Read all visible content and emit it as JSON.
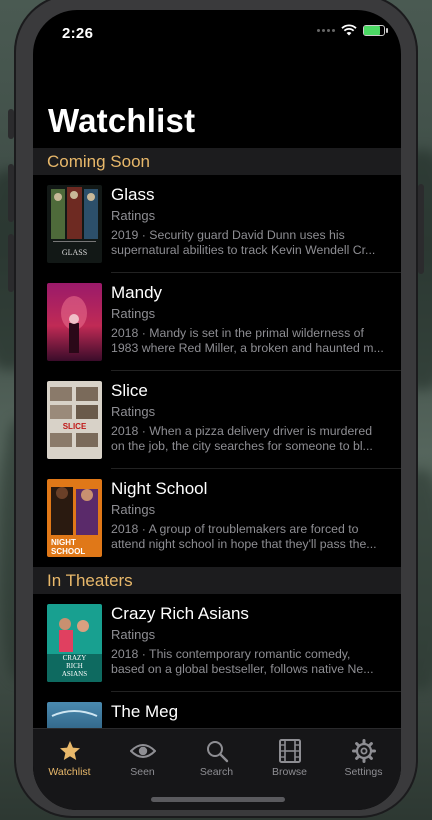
{
  "status": {
    "time": "2:26"
  },
  "page": {
    "title": "Watchlist"
  },
  "sections": [
    {
      "header": "Coming Soon",
      "movies": [
        {
          "title": "Glass",
          "ratings": "Ratings",
          "desc_line1": "2019 · Security guard David Dunn uses his",
          "desc_line2": "supernatural abilities to track Kevin Wendell Cr...",
          "poster_text": "GLASS"
        },
        {
          "title": "Mandy",
          "ratings": "Ratings",
          "desc_line1": "2018 · Mandy is set in the primal wilderness of",
          "desc_line2": "1983 where Red Miller, a broken and haunted m...",
          "poster_text": ""
        },
        {
          "title": "Slice",
          "ratings": "Ratings",
          "desc_line1": "2018 · When a pizza delivery driver is murdered",
          "desc_line2": "on the job, the city searches for someone to bl...",
          "poster_text": "SLICE"
        },
        {
          "title": "Night School",
          "ratings": "Ratings",
          "desc_line1": "2018 · A group of troublemakers are forced to",
          "desc_line2": "attend night school in hope that they'll pass the...",
          "poster_text_1": "NIGHT",
          "poster_text_2": "SCHOOL"
        }
      ]
    },
    {
      "header": "In Theaters",
      "movies": [
        {
          "title": "Crazy Rich Asians",
          "ratings": "Ratings",
          "desc_line1": "2018 · This contemporary romantic comedy,",
          "desc_line2": "based on a global bestseller, follows native Ne...",
          "poster_text_1": "CRAZY",
          "poster_text_2": "RICH",
          "poster_text_3": "ASIANS"
        },
        {
          "title": "The Meg",
          "ratings": "",
          "desc_line1": "",
          "desc_line2": ""
        }
      ]
    }
  ],
  "tabs": [
    {
      "label": "Watchlist",
      "icon": "star-icon",
      "active": true
    },
    {
      "label": "Seen",
      "icon": "eye-icon",
      "active": false
    },
    {
      "label": "Search",
      "icon": "search-icon",
      "active": false
    },
    {
      "label": "Browse",
      "icon": "film-icon",
      "active": false
    },
    {
      "label": "Settings",
      "icon": "gear-icon",
      "active": false
    }
  ],
  "colors": {
    "accent": "#e8b86a",
    "background": "#000000",
    "section_bg": "#1c1c1e",
    "secondary_text": "#8e8e93"
  }
}
